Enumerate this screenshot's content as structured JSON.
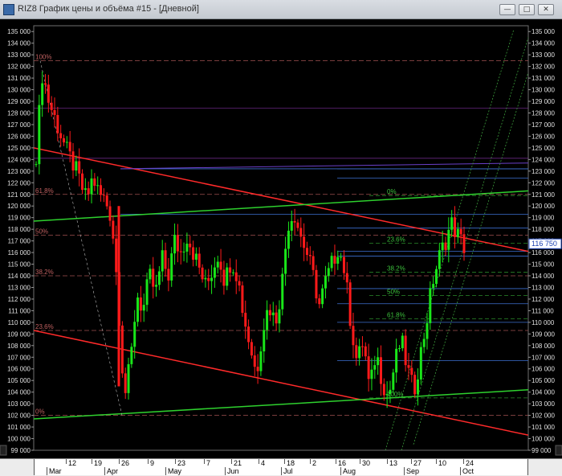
{
  "window": {
    "title": "RIZ8 График цены и объёма #15 - [Дневной]",
    "buttons": [
      "minimize",
      "restore",
      "close"
    ]
  },
  "chart_data": {
    "type": "candlestick",
    "ylim": [
      99000,
      135500
    ],
    "ytick_step": 1000,
    "price_label": "116 750",
    "colors": {
      "up": "#19e619",
      "down": "#ff1a1a",
      "trend_red": "#ff2a2a",
      "trend_green": "#2ed12e",
      "fib": "#a05050",
      "grid_blue": "#3c6fd0"
    },
    "x_labels": [
      {
        "text": "12",
        "level": "day"
      },
      {
        "text": "19",
        "level": "day"
      },
      {
        "text": "26",
        "level": "day"
      },
      {
        "text": "9",
        "level": "day"
      },
      {
        "text": "23",
        "level": "day"
      },
      {
        "text": "7",
        "level": "day"
      },
      {
        "text": "21",
        "level": "day"
      },
      {
        "text": "4",
        "level": "day"
      },
      {
        "text": "18",
        "level": "day"
      },
      {
        "text": "2",
        "level": "day"
      },
      {
        "text": "16",
        "level": "day"
      },
      {
        "text": "30",
        "level": "day"
      },
      {
        "text": "13",
        "level": "day"
      },
      {
        "text": "27",
        "level": "day"
      },
      {
        "text": "10",
        "level": "day"
      },
      {
        "text": "24",
        "level": "day"
      },
      {
        "text": "Mar",
        "level": "month"
      },
      {
        "text": "Apr",
        "level": "month"
      },
      {
        "text": "May",
        "level": "month"
      },
      {
        "text": "Jun",
        "level": "month"
      },
      {
        "text": "Jul",
        "level": "month"
      },
      {
        "text": "Aug",
        "level": "month"
      },
      {
        "text": "Sep",
        "level": "month"
      },
      {
        "text": "Oct",
        "level": "month"
      }
    ],
    "fib_left": [
      {
        "label": "100%",
        "value": 132500
      },
      {
        "label": "61.8%",
        "value": 121000
      },
      {
        "label": "50%",
        "value": 117500
      },
      {
        "label": "38.2%",
        "value": 114000
      },
      {
        "label": "23.6%",
        "value": 109300
      },
      {
        "label": "0%",
        "value": 102000
      }
    ],
    "fib_right": [
      {
        "label": "0%",
        "value": 120900
      },
      {
        "label": "23.6%",
        "value": 116800
      },
      {
        "label": "38.2%",
        "value": 114300
      },
      {
        "label": "50%",
        "value": 112300
      },
      {
        "label": "61.8%",
        "value": 110300
      },
      {
        "label": "100%",
        "value": 103500
      }
    ],
    "candle_path": [
      124500,
      131500,
      129000,
      127500,
      126000,
      124500,
      123500,
      122000,
      120500,
      122500,
      121000,
      120500,
      119000,
      112500,
      103500,
      106500,
      112500,
      111000,
      114000,
      112500,
      115500,
      114000,
      117000,
      116000,
      117500,
      116000,
      114500,
      113000,
      114500,
      116000,
      113500,
      115500,
      114000,
      110500,
      108000,
      105500,
      109500,
      111500,
      110000,
      113000,
      118500,
      119500,
      117500,
      116000,
      114000,
      111500,
      113500,
      115000,
      116500,
      114500,
      110000,
      106500,
      108500,
      104000,
      107500,
      105000,
      103500,
      106500,
      108500,
      106000,
      104000,
      107000,
      110000,
      113500,
      115500,
      117000,
      118500,
      117500,
      116500
    ]
  }
}
